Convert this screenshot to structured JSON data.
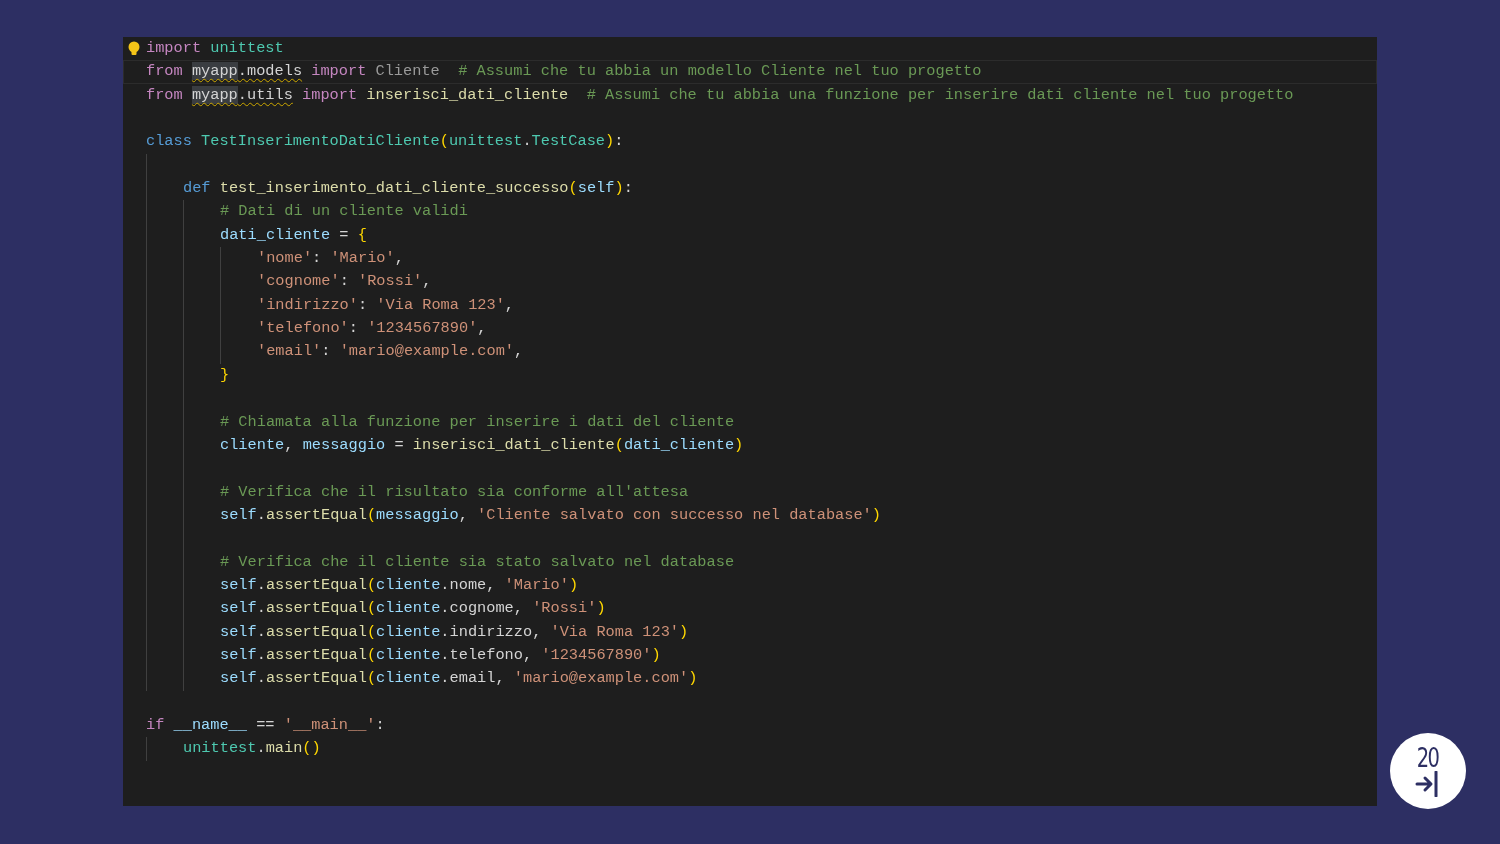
{
  "editor": {
    "lines": [
      {
        "kind": "code",
        "current": false,
        "tokens": [
          {
            "text": "import ",
            "kind": "keyword"
          },
          {
            "text": "unittest",
            "kind": "module"
          }
        ]
      },
      {
        "kind": "code",
        "current": true,
        "tokens": [
          {
            "text": "from ",
            "kind": "keyword"
          },
          {
            "text": "myapp",
            "kind": "plain",
            "highlight": true,
            "squiggle": true
          },
          {
            "text": ".models",
            "kind": "plain",
            "squiggle": true
          },
          {
            "text": " import ",
            "kind": "keyword"
          },
          {
            "text": "Cliente",
            "kind": "unused"
          },
          {
            "text": "  # Assumi che tu abbia un modello Cliente nel tuo progetto",
            "kind": "comment"
          }
        ]
      },
      {
        "kind": "code",
        "current": false,
        "tokens": [
          {
            "text": "from ",
            "kind": "keyword"
          },
          {
            "text": "myapp",
            "kind": "plain",
            "highlight": true,
            "squiggle": true
          },
          {
            "text": ".utils",
            "kind": "plain",
            "squiggle": true
          },
          {
            "text": " import ",
            "kind": "keyword"
          },
          {
            "text": "inserisci_dati_cliente",
            "kind": "function"
          },
          {
            "text": "  # Assumi che tu abbia una funzione per inserire dati cliente nel tuo progetto",
            "kind": "comment"
          }
        ]
      },
      {
        "kind": "blank"
      },
      {
        "kind": "code",
        "current": false,
        "tokens": [
          {
            "text": "class ",
            "kind": "storage"
          },
          {
            "text": "TestInserimentoDatiCliente",
            "kind": "type"
          },
          {
            "text": "(",
            "kind": "bracket"
          },
          {
            "text": "unittest",
            "kind": "type"
          },
          {
            "text": ".",
            "kind": "plain"
          },
          {
            "text": "TestCase",
            "kind": "type"
          },
          {
            "text": ")",
            "kind": "bracket"
          },
          {
            "text": ":",
            "kind": "plain"
          }
        ],
        "children": [
          {
            "kind": "blank"
          },
          {
            "kind": "code",
            "current": false,
            "tokens": [
              {
                "text": "def ",
                "kind": "storage"
              },
              {
                "text": "test_inserimento_dati_cliente_successo",
                "kind": "function"
              },
              {
                "text": "(",
                "kind": "bracket"
              },
              {
                "text": "self",
                "kind": "variable"
              },
              {
                "text": ")",
                "kind": "bracket"
              },
              {
                "text": ":",
                "kind": "plain"
              }
            ],
            "children": [
              {
                "kind": "code",
                "current": false,
                "tokens": [
                  {
                    "text": "# Dati di un cliente validi",
                    "kind": "comment"
                  }
                ]
              },
              {
                "kind": "code",
                "current": false,
                "tokens": [
                  {
                    "text": "dati_cliente",
                    "kind": "variable"
                  },
                  {
                    "text": " = ",
                    "kind": "plain"
                  },
                  {
                    "text": "{",
                    "kind": "bracket"
                  }
                ],
                "children": [
                  {
                    "kind": "code",
                    "current": false,
                    "tokens": [
                      {
                        "text": "'nome'",
                        "kind": "string"
                      },
                      {
                        "text": ": ",
                        "kind": "plain"
                      },
                      {
                        "text": "'Mario'",
                        "kind": "string"
                      },
                      {
                        "text": ",",
                        "kind": "plain"
                      }
                    ]
                  },
                  {
                    "kind": "code",
                    "current": false,
                    "tokens": [
                      {
                        "text": "'cognome'",
                        "kind": "string"
                      },
                      {
                        "text": ": ",
                        "kind": "plain"
                      },
                      {
                        "text": "'Rossi'",
                        "kind": "string"
                      },
                      {
                        "text": ",",
                        "kind": "plain"
                      }
                    ]
                  },
                  {
                    "kind": "code",
                    "current": false,
                    "tokens": [
                      {
                        "text": "'indirizzo'",
                        "kind": "string"
                      },
                      {
                        "text": ": ",
                        "kind": "plain"
                      },
                      {
                        "text": "'Via Roma 123'",
                        "kind": "string"
                      },
                      {
                        "text": ",",
                        "kind": "plain"
                      }
                    ]
                  },
                  {
                    "kind": "code",
                    "current": false,
                    "tokens": [
                      {
                        "text": "'telefono'",
                        "kind": "string"
                      },
                      {
                        "text": ": ",
                        "kind": "plain"
                      },
                      {
                        "text": "'1234567890'",
                        "kind": "string"
                      },
                      {
                        "text": ",",
                        "kind": "plain"
                      }
                    ]
                  },
                  {
                    "kind": "code",
                    "current": false,
                    "tokens": [
                      {
                        "text": "'email'",
                        "kind": "string"
                      },
                      {
                        "text": ": ",
                        "kind": "plain"
                      },
                      {
                        "text": "'mario@example.com'",
                        "kind": "string"
                      },
                      {
                        "text": ",",
                        "kind": "plain"
                      }
                    ]
                  }
                ]
              },
              {
                "kind": "code",
                "current": false,
                "tokens": [
                  {
                    "text": "}",
                    "kind": "bracket"
                  }
                ]
              },
              {
                "kind": "blank"
              },
              {
                "kind": "code",
                "current": false,
                "tokens": [
                  {
                    "text": "# Chiamata alla funzione per inserire i dati del cliente",
                    "kind": "comment"
                  }
                ]
              },
              {
                "kind": "code",
                "current": false,
                "tokens": [
                  {
                    "text": "cliente",
                    "kind": "variable"
                  },
                  {
                    "text": ", ",
                    "kind": "plain"
                  },
                  {
                    "text": "messaggio",
                    "kind": "variable"
                  },
                  {
                    "text": " = ",
                    "kind": "plain"
                  },
                  {
                    "text": "inserisci_dati_cliente",
                    "kind": "function"
                  },
                  {
                    "text": "(",
                    "kind": "bracket"
                  },
                  {
                    "text": "dati_cliente",
                    "kind": "variable"
                  },
                  {
                    "text": ")",
                    "kind": "bracket"
                  }
                ]
              },
              {
                "kind": "blank"
              },
              {
                "kind": "code",
                "current": false,
                "tokens": [
                  {
                    "text": "# Verifica che il risultato sia conforme all'attesa",
                    "kind": "comment"
                  }
                ]
              },
              {
                "kind": "code",
                "current": false,
                "tokens": [
                  {
                    "text": "self",
                    "kind": "variable"
                  },
                  {
                    "text": ".",
                    "kind": "plain"
                  },
                  {
                    "text": "assertEqual",
                    "kind": "function"
                  },
                  {
                    "text": "(",
                    "kind": "bracket"
                  },
                  {
                    "text": "messaggio",
                    "kind": "variable"
                  },
                  {
                    "text": ", ",
                    "kind": "plain"
                  },
                  {
                    "text": "'Cliente salvato con successo nel database'",
                    "kind": "string"
                  },
                  {
                    "text": ")",
                    "kind": "bracket"
                  }
                ]
              },
              {
                "kind": "blank"
              },
              {
                "kind": "code",
                "current": false,
                "tokens": [
                  {
                    "text": "# Verifica che il cliente sia stato salvato nel database",
                    "kind": "comment"
                  }
                ]
              },
              {
                "kind": "code",
                "current": false,
                "tokens": [
                  {
                    "text": "self",
                    "kind": "variable"
                  },
                  {
                    "text": ".",
                    "kind": "plain"
                  },
                  {
                    "text": "assertEqual",
                    "kind": "function"
                  },
                  {
                    "text": "(",
                    "kind": "bracket"
                  },
                  {
                    "text": "cliente",
                    "kind": "variable"
                  },
                  {
                    "text": ".nome, ",
                    "kind": "plain"
                  },
                  {
                    "text": "'Mario'",
                    "kind": "string"
                  },
                  {
                    "text": ")",
                    "kind": "bracket"
                  }
                ]
              },
              {
                "kind": "code",
                "current": false,
                "tokens": [
                  {
                    "text": "self",
                    "kind": "variable"
                  },
                  {
                    "text": ".",
                    "kind": "plain"
                  },
                  {
                    "text": "assertEqual",
                    "kind": "function"
                  },
                  {
                    "text": "(",
                    "kind": "bracket"
                  },
                  {
                    "text": "cliente",
                    "kind": "variable"
                  },
                  {
                    "text": ".cognome, ",
                    "kind": "plain"
                  },
                  {
                    "text": "'Rossi'",
                    "kind": "string"
                  },
                  {
                    "text": ")",
                    "kind": "bracket"
                  }
                ]
              },
              {
                "kind": "code",
                "current": false,
                "tokens": [
                  {
                    "text": "self",
                    "kind": "variable"
                  },
                  {
                    "text": ".",
                    "kind": "plain"
                  },
                  {
                    "text": "assertEqual",
                    "kind": "function"
                  },
                  {
                    "text": "(",
                    "kind": "bracket"
                  },
                  {
                    "text": "cliente",
                    "kind": "variable"
                  },
                  {
                    "text": ".indirizzo, ",
                    "kind": "plain"
                  },
                  {
                    "text": "'Via Roma 123'",
                    "kind": "string"
                  },
                  {
                    "text": ")",
                    "kind": "bracket"
                  }
                ]
              },
              {
                "kind": "code",
                "current": false,
                "tokens": [
                  {
                    "text": "self",
                    "kind": "variable"
                  },
                  {
                    "text": ".",
                    "kind": "plain"
                  },
                  {
                    "text": "assertEqual",
                    "kind": "function"
                  },
                  {
                    "text": "(",
                    "kind": "bracket"
                  },
                  {
                    "text": "cliente",
                    "kind": "variable"
                  },
                  {
                    "text": ".telefono, ",
                    "kind": "plain"
                  },
                  {
                    "text": "'1234567890'",
                    "kind": "string"
                  },
                  {
                    "text": ")",
                    "kind": "bracket"
                  }
                ]
              },
              {
                "kind": "code",
                "current": false,
                "tokens": [
                  {
                    "text": "self",
                    "kind": "variable"
                  },
                  {
                    "text": ".",
                    "kind": "plain"
                  },
                  {
                    "text": "assertEqual",
                    "kind": "function"
                  },
                  {
                    "text": "(",
                    "kind": "bracket"
                  },
                  {
                    "text": "cliente",
                    "kind": "variable"
                  },
                  {
                    "text": ".email, ",
                    "kind": "plain"
                  },
                  {
                    "text": "'mario@example.com'",
                    "kind": "string"
                  },
                  {
                    "text": ")",
                    "kind": "bracket"
                  }
                ]
              }
            ]
          }
        ]
      },
      {
        "kind": "blank"
      },
      {
        "kind": "code",
        "current": false,
        "tokens": [
          {
            "text": "if ",
            "kind": "keyword"
          },
          {
            "text": "__name__",
            "kind": "variable"
          },
          {
            "text": " == ",
            "kind": "plain"
          },
          {
            "text": "'__main__'",
            "kind": "string"
          },
          {
            "text": ":",
            "kind": "plain"
          }
        ],
        "children": [
          {
            "kind": "code",
            "current": false,
            "tokens": [
              {
                "text": "unittest",
                "kind": "module"
              },
              {
                "text": ".",
                "kind": "plain"
              },
              {
                "text": "main",
                "kind": "function"
              },
              {
                "text": "()",
                "kind": "bracket"
              }
            ]
          }
        ]
      }
    ]
  },
  "logo": {
    "text": "20"
  }
}
